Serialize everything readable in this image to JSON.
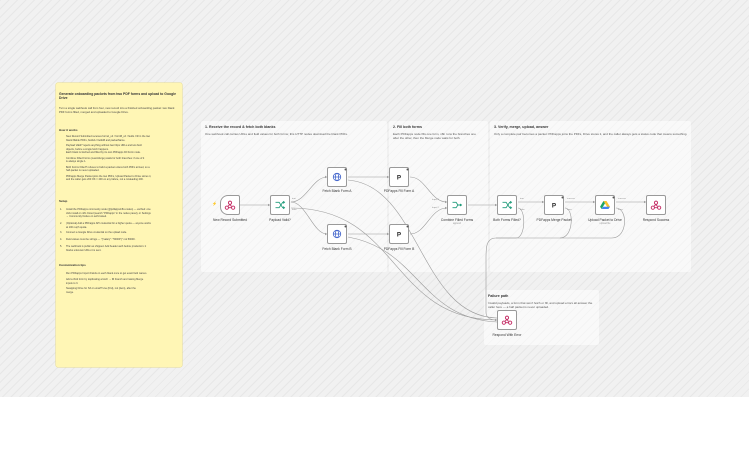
{
  "colors": {
    "accent": "#e76b2b",
    "sticky": "#fff6b5",
    "edge": "#9a9a9a",
    "webhook": "#c42a63",
    "http": "#3a5ec9",
    "switch": "#1f9b7a",
    "drive_green": "#1fa463",
    "drive_yellow": "#f7c231",
    "drive_blue": "#4285f4"
  },
  "sticky": {
    "title": "Generate onboarding packets from two PDF forms and upload to Google Drive",
    "intro": "Turn a single webhook call from four, new record into a finished onboarding packet: two blank PDF forms filled, merged and uploaded to Google Drive.",
    "how_heading": "How it works",
    "how_items": [
      "New Record Submitted receives formA_url / formB_url / fields. Fill in the two",
      "blank fillable PDFs, fieldsA / fieldsB and packetName.",
      "Payload Valid? rejects anything without two https URLs and two field",
      "objects, before a single fetch happens.",
      "Each blank is fetched and filled by its own PDFapps Fill Form node.",
      "Combine Filled Forms (Last-Merge) waits for both branches: if one of it",
      "is always single 1.",
      "Both Forms Filled? refuses to build a packet unless both PDFs arrived, so a",
      "half-packet is never uploaded.",
      "PDFapps Merge Packet joins the two PDFs, Upload Packet to Drive stores it,",
      "and the caller gets 200 OK = 400 on any failure, not a misleading 200."
    ],
    "setup_heading": "Setup",
    "setup_items": [
      "Install the PDFapps community node (@pdfapps/n8n-nodes) — verified: one",
      "click install on n8n Cloud (search \"PDFapps\" in the nodes panel), or Settings",
      "→ Community Nodes on self-hosted.",
      "(Optional) Add a PDFapps API credential for a higher quota — anyone works",
      "at 100 req/h quota.",
      "Connect a Google Drive credential on the upload node.",
      "Field values must be strings — \"{\"salary\": \"50000\"}\" not 50000.",
      "The webhook is public as shipped. Add header auth before production: it",
      "blocks unknown URLs it is sent."
    ],
    "custom_heading": "Customization tips",
    "custom_items": [
      "Run PDFapps Import Fields on each blank once to get exact field names.",
      "Add a third form by duplicating a fetch → fill branch and raising Merge",
      "inputs to 3.",
      "Swapping Drive for S3 or email? Use {first}, not {item}, after the",
      "merge."
    ]
  },
  "groups": [
    {
      "title": "1. Receive the record & fetch both blanks",
      "desc": "One webhook call carries URLs and field values for both forms; this HTTP nodes download the blank PDFs."
    },
    {
      "title": "2. Fill both forms",
      "desc": "Each PDFapps node fills one form, n8n runs the branches one after the other, then the Merge node waits for both."
    },
    {
      "title": "3. Verify, merge, upload, answer",
      "desc": "Only a complete pair becomes a packet: PDFapps joins the PDFs, Drive stores it, and the caller always gets a status code that means something."
    },
    {
      "title": "Failure path",
      "desc": "Invalid payloads, a form that won't fetch or fill, and upload errors all answer the caller here — a half packet is never uploaded."
    }
  ],
  "nodes": {
    "webhook": {
      "label": "New Record Submitted"
    },
    "valid": {
      "label": "Payload Valid?"
    },
    "fetchA": {
      "label": "Fetch Blank Form A"
    },
    "fetchB": {
      "label": "Fetch Blank Form B"
    },
    "fillA": {
      "label": "PDFapps Fill Form A"
    },
    "fillB": {
      "label": "PDFapps Fill Form B"
    },
    "combine": {
      "label": "Combine Filled Forms",
      "sub": "append"
    },
    "both": {
      "label": "Both Forms Filled?"
    },
    "mergepkt": {
      "label": "PDFapps Merge Packet"
    },
    "upload": {
      "label": "Upload Packet to Drive",
      "sub": "upload file"
    },
    "success": {
      "label": "Respond Success"
    },
    "error": {
      "label": "Respond With Error"
    }
  },
  "ports": {
    "true": "true",
    "false": "false",
    "input1": "Input 1",
    "input2": "Input 2",
    "success": "success",
    "error": "error"
  },
  "pdf_glyph": "P",
  "trigger_glyph": "⚡"
}
